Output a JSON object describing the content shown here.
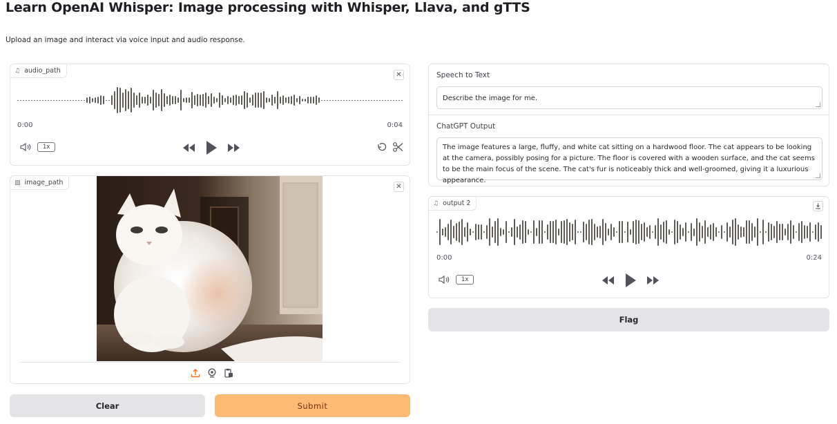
{
  "page": {
    "title": "Learn OpenAI Whisper: Image processing with Whisper, Llava, and gTTS",
    "description": "Upload an image and interact via voice input and audio response."
  },
  "audio_input": {
    "label": "audio_path",
    "time_start": "0:00",
    "time_end": "0:04",
    "speed": "1x"
  },
  "image_input": {
    "label": "image_path"
  },
  "speech_to_text": {
    "label": "Speech to Text",
    "value": "Describe the image for me."
  },
  "chatgpt_output": {
    "label": "ChatGPT Output",
    "value": "The image features a large, fluffy, and white cat sitting on a hardwood floor. The cat appears to be looking at the camera, possibly posing for a picture. The floor is covered with a wooden surface, and the cat seems to be the main focus of the scene. The cat's fur is noticeably thick and well-groomed, giving it a luxurious appearance."
  },
  "audio_output": {
    "label": "output 2",
    "time_start": "0:00",
    "time_end": "0:24",
    "speed": "1x"
  },
  "buttons": {
    "clear": "Clear",
    "submit": "Submit",
    "flag": "Flag"
  },
  "colors": {
    "accent": "#fdba74",
    "button_gray": "#e4e4e7",
    "waveform": "#5e5a55"
  },
  "icons": [
    "music-note-icon",
    "close-icon",
    "volume-icon",
    "rewind-icon",
    "play-icon",
    "fast-forward-icon",
    "undo-icon",
    "scissors-icon",
    "image-icon",
    "upload-icon",
    "webcam-icon",
    "clipboard-icon",
    "download-icon"
  ]
}
